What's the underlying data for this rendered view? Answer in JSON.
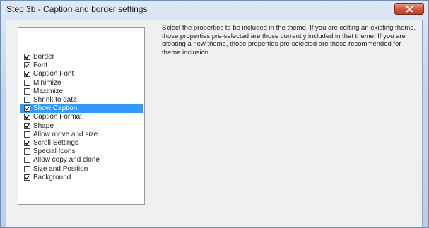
{
  "window": {
    "title": "Step 3b - Caption and border settings",
    "close_icon": "close-icon"
  },
  "properties": {
    "items": [
      {
        "label": "Border",
        "checked": true,
        "selected": false
      },
      {
        "label": "Font",
        "checked": true,
        "selected": false
      },
      {
        "label": "Caption Font",
        "checked": true,
        "selected": false
      },
      {
        "label": "Minimize",
        "checked": false,
        "selected": false
      },
      {
        "label": "Maximize",
        "checked": false,
        "selected": false
      },
      {
        "label": "Shrink to data",
        "checked": false,
        "selected": false
      },
      {
        "label": "Show Caption",
        "checked": true,
        "selected": true
      },
      {
        "label": "Caption Format",
        "checked": true,
        "selected": false
      },
      {
        "label": "Shape",
        "checked": true,
        "selected": false
      },
      {
        "label": "Allow move and size",
        "checked": false,
        "selected": false
      },
      {
        "label": "Scroll Settings",
        "checked": true,
        "selected": false
      },
      {
        "label": "Special Icons",
        "checked": false,
        "selected": false
      },
      {
        "label": "Allow copy and clone",
        "checked": false,
        "selected": false
      },
      {
        "label": "Size and Position",
        "checked": false,
        "selected": false
      },
      {
        "label": "Background",
        "checked": true,
        "selected": false
      }
    ]
  },
  "description": {
    "text": "Select the properties to be included in the theme. If you are editing an existing theme, those properties pre-selected are those currently included in that theme. If you are creating a new theme, those properties pre-selected are those recommended for theme inclusion."
  },
  "colors": {
    "selection": "#3399ff",
    "close_button": "#c13a22"
  }
}
